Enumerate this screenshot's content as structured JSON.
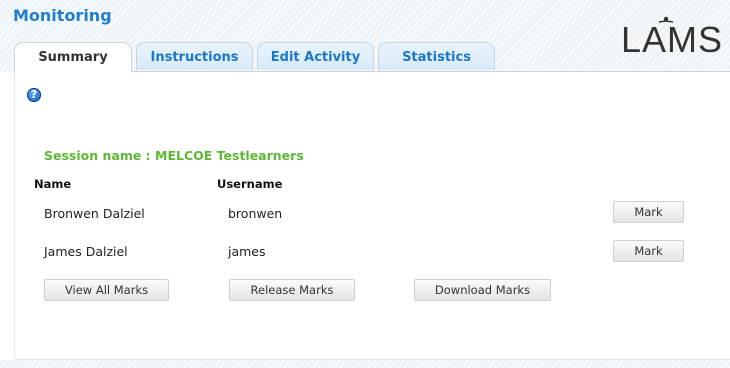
{
  "header": {
    "title": "Monitoring",
    "logo_text": "LAMS"
  },
  "tabs": [
    {
      "label": "Summary",
      "active": true
    },
    {
      "label": "Instructions",
      "active": false
    },
    {
      "label": "Edit Activity",
      "active": false
    },
    {
      "label": "Statistics",
      "active": false
    }
  ],
  "help_icon": {
    "glyph": "?"
  },
  "session": {
    "name_label": "Session name : MELCOE Testlearners"
  },
  "table": {
    "columns": [
      "Name",
      "Username"
    ],
    "rows": [
      {
        "name": "Bronwen Dalziel",
        "username": "bronwen",
        "action": "Mark"
      },
      {
        "name": "James Dalziel",
        "username": "james",
        "action": "Mark"
      }
    ]
  },
  "actions": {
    "view_all": "View All Marks",
    "release": "Release Marks",
    "download": "Download Marks"
  },
  "colors": {
    "title": "#1f7fcb",
    "tab_text": "#1a78c8",
    "session": "#5cb832"
  }
}
